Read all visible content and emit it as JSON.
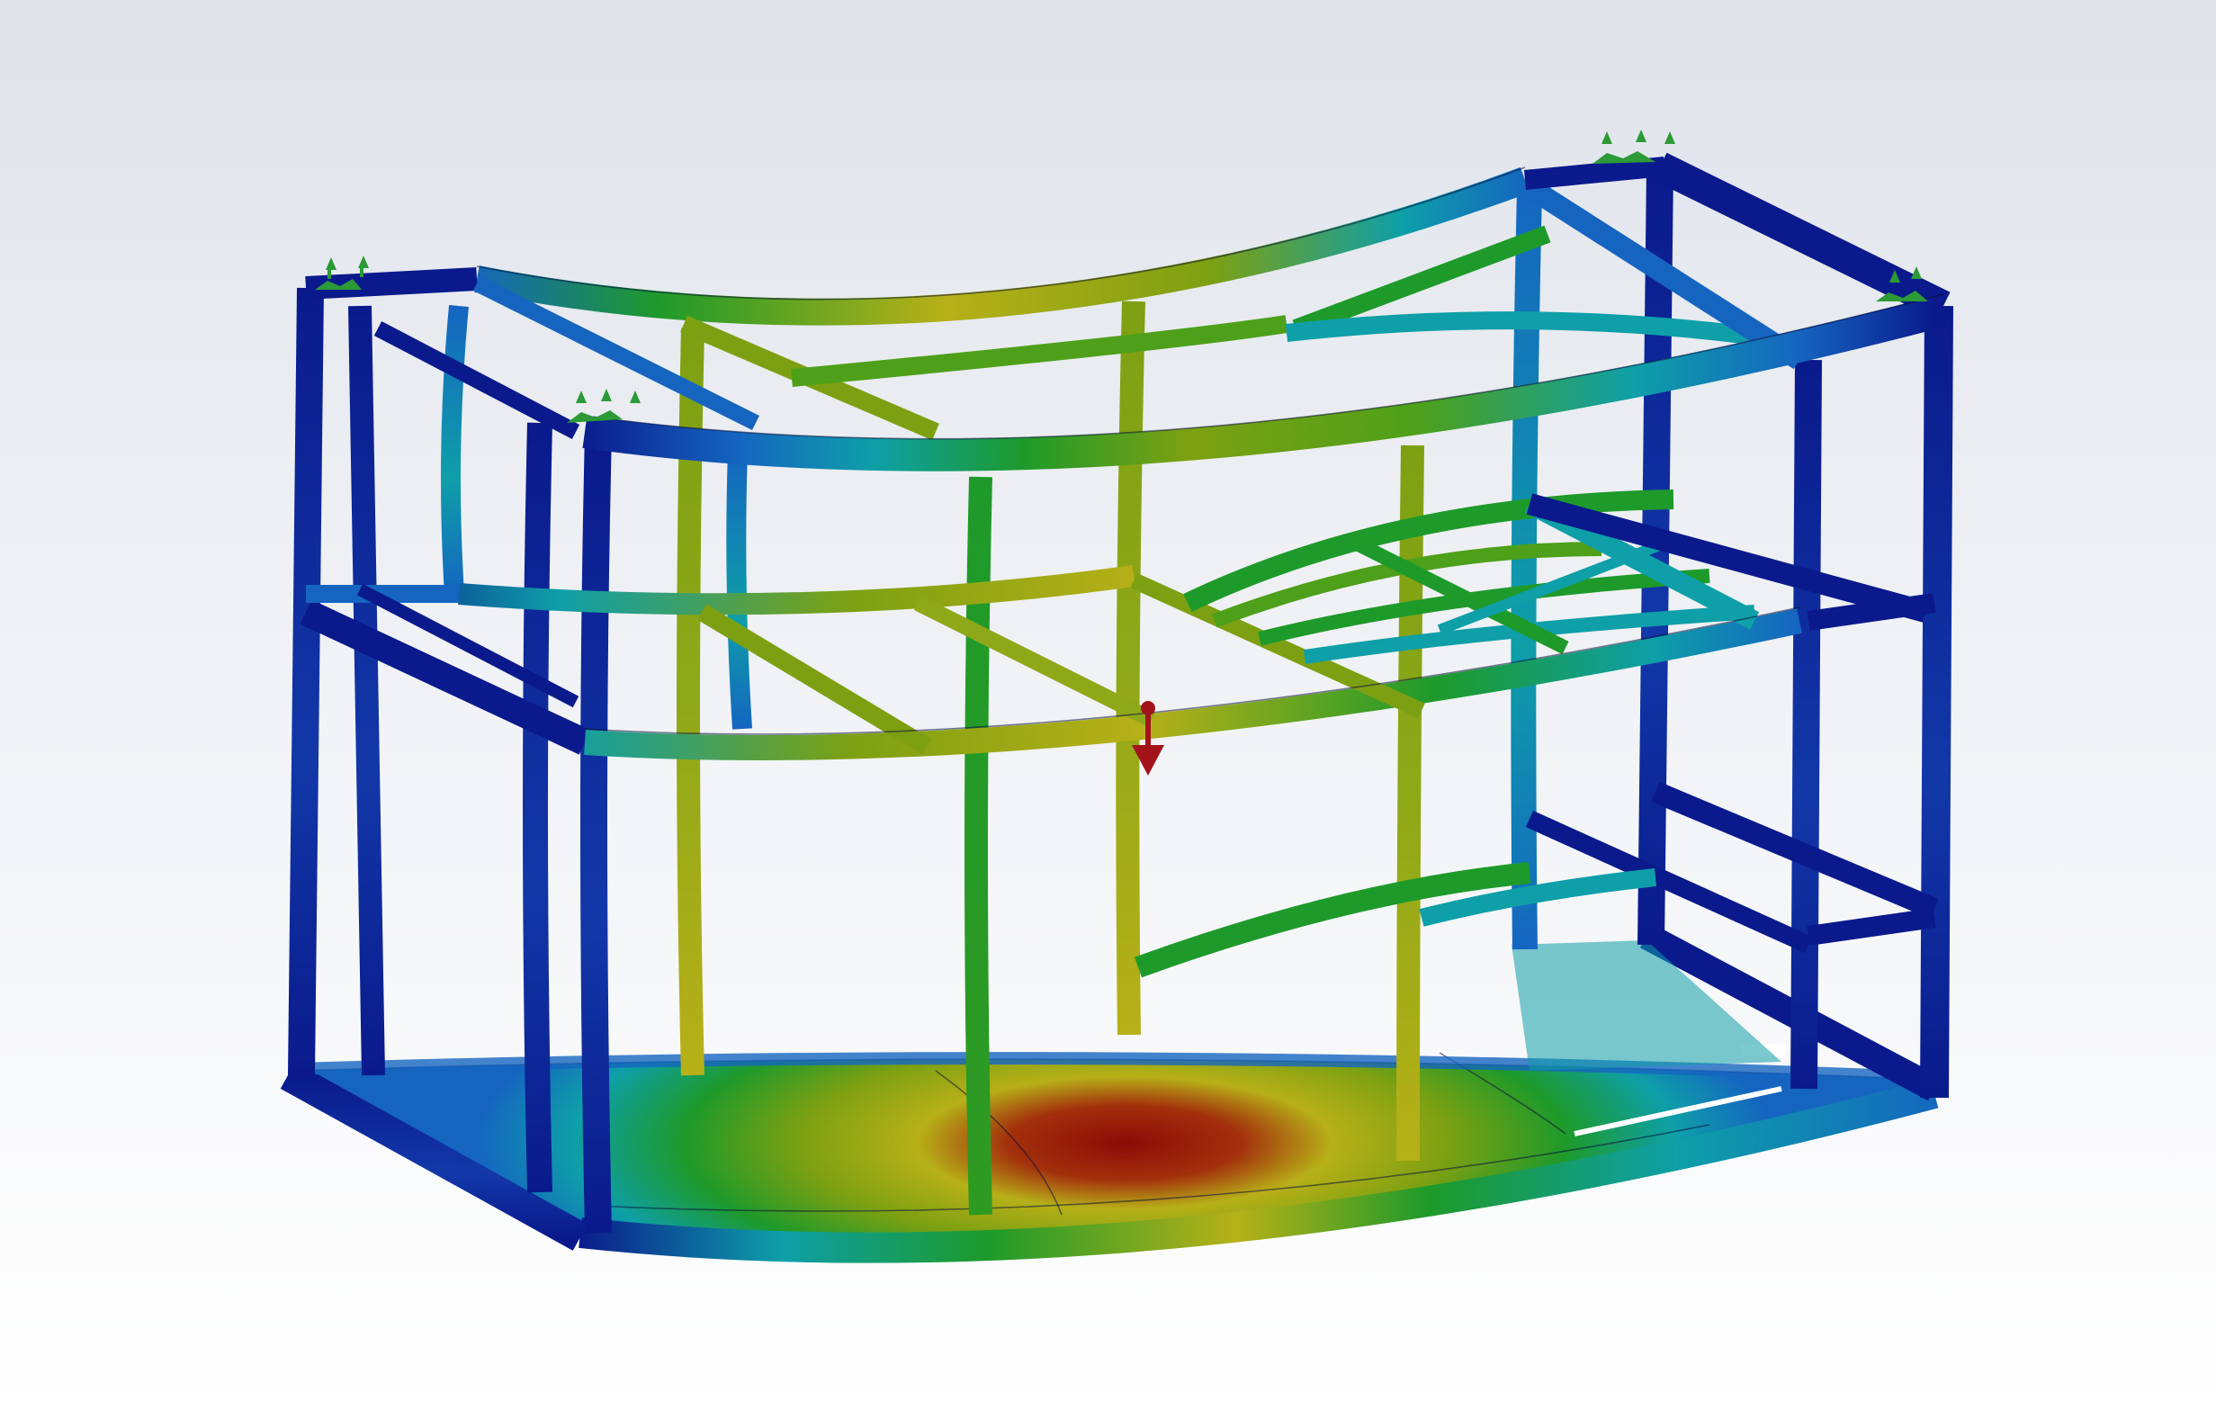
{
  "viewport": {
    "background_top": "#dfe3ea",
    "background_bottom": "#ffffff"
  },
  "result_colormap": [
    "#0a1a8c",
    "#1565c0",
    "#0e9fa8",
    "#1e9a2a",
    "#7da012",
    "#b7b018",
    "#c86a10",
    "#8a0c06"
  ],
  "icons": {
    "fixture": "fixed-geometry-icon",
    "load": "force-load-arrow-icon"
  },
  "colors": {
    "fixture_green": "#2c9a36",
    "load_red": "#a3141a"
  }
}
